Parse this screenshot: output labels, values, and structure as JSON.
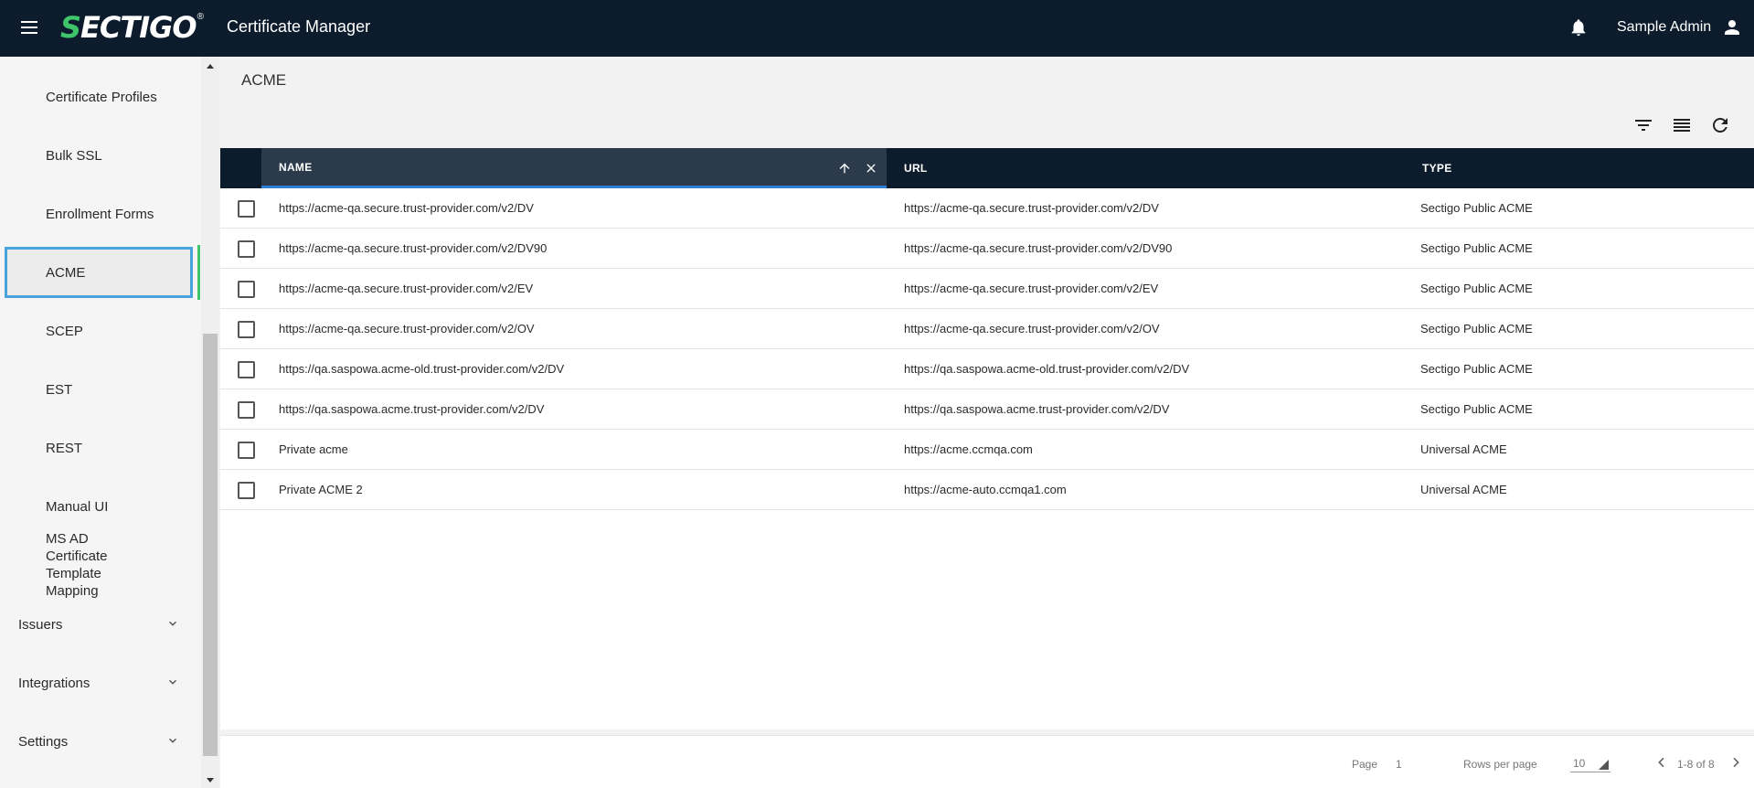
{
  "header": {
    "logo_text": "SECTIGO",
    "logo_registered": "®",
    "app_title": "Certificate Manager",
    "user_name": "Sample Admin"
  },
  "sidebar": {
    "items": [
      {
        "label": "Certificate Profiles"
      },
      {
        "label": "Bulk SSL"
      },
      {
        "label": "Enrollment Forms"
      },
      {
        "label": "ACME",
        "active": true
      },
      {
        "label": "SCEP"
      },
      {
        "label": "EST"
      },
      {
        "label": "REST"
      },
      {
        "label": "Manual UI"
      },
      {
        "label": "MS AD Certificate Template Mapping"
      }
    ],
    "groups": [
      {
        "label": "Issuers"
      },
      {
        "label": "Integrations"
      },
      {
        "label": "Settings"
      }
    ]
  },
  "main": {
    "page_title": "ACME",
    "table": {
      "columns": [
        {
          "label": "NAME"
        },
        {
          "label": "URL"
        },
        {
          "label": "TYPE"
        }
      ],
      "rows": [
        {
          "name": "https://acme-qa.secure.trust-provider.com/v2/DV",
          "url": "https://acme-qa.secure.trust-provider.com/v2/DV",
          "type": "Sectigo Public ACME"
        },
        {
          "name": "https://acme-qa.secure.trust-provider.com/v2/DV90",
          "url": "https://acme-qa.secure.trust-provider.com/v2/DV90",
          "type": "Sectigo Public ACME"
        },
        {
          "name": "https://acme-qa.secure.trust-provider.com/v2/EV",
          "url": "https://acme-qa.secure.trust-provider.com/v2/EV",
          "type": "Sectigo Public ACME"
        },
        {
          "name": "https://acme-qa.secure.trust-provider.com/v2/OV",
          "url": "https://acme-qa.secure.trust-provider.com/v2/OV",
          "type": "Sectigo Public ACME"
        },
        {
          "name": "https://qa.saspowa.acme-old.trust-provider.com/v2/DV",
          "url": "https://qa.saspowa.acme-old.trust-provider.com/v2/DV",
          "type": "Sectigo Public ACME"
        },
        {
          "name": "https://qa.saspowa.acme.trust-provider.com/v2/DV",
          "url": "https://qa.saspowa.acme.trust-provider.com/v2/DV",
          "type": "Sectigo Public ACME"
        },
        {
          "name": "Private acme",
          "url": "https://acme.ccmqa.com",
          "type": "Universal ACME"
        },
        {
          "name": "Private ACME 2",
          "url": "https://acme-auto.ccmqa1.com",
          "type": "Universal ACME"
        }
      ]
    },
    "pagination": {
      "page_label": "Page",
      "page_value": "1",
      "rows_label": "Rows per page",
      "rows_value": "10",
      "range": "1-8 of 8"
    }
  },
  "colors": {
    "header_bg": "#0c1c2c",
    "accent_green": "#3ec46b",
    "focus_blue": "#4aa3dd"
  },
  "icons": [
    "menu-icon",
    "bell-icon",
    "user-icon",
    "filter-icon",
    "columns-icon",
    "refresh-icon",
    "sort-up-icon",
    "close-icon",
    "chevron-down-icon",
    "chevron-left-icon",
    "chevron-right-icon"
  ]
}
